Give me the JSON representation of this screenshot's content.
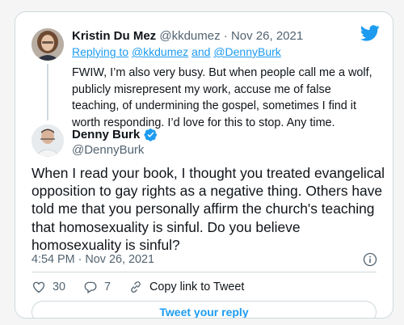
{
  "reply_tweet": {
    "display_name": "Kristin Du Mez",
    "handle": "@kkdumez",
    "separator": "·",
    "date": "Nov 26, 2021",
    "replying_prefix": "Replying to",
    "replying_to_1": "@kkdumez",
    "replying_and": "and",
    "replying_to_2": "@DennyBurk",
    "text": "FWIW, I’m also very busy. But when people call me a wolf, publicly misrepresent my work, accuse me of false teaching, of undermining the gospel, sometimes I find it worth responding. I’d love for this to stop. Any time."
  },
  "main_tweet": {
    "display_name": "Denny Burk",
    "handle": "@DennyBurk",
    "verified": true,
    "text": "When I read your book, I thought you treated evangelical opposition to gay rights as a negative thing. Others have told me that you personally affirm the church's teaching that homosexuality is sinful. Do you believe homosexuality is sinful?",
    "timestamp": "4:54 PM · Nov 26, 2021"
  },
  "actions": {
    "likes": "30",
    "replies": "7",
    "copy_link_label": "Copy link to Tweet"
  },
  "reply_button_label": "Tweet your reply",
  "icons": {
    "logo": "twitter-bird-icon",
    "verified": "verified-badge-icon",
    "info": "info-icon",
    "like": "heart-icon",
    "reply": "speech-bubble-icon",
    "link": "link-icon"
  },
  "colors": {
    "accent": "#1d9bf0",
    "text": "#0f1419",
    "muted": "#536471",
    "border": "#cfd9de"
  }
}
